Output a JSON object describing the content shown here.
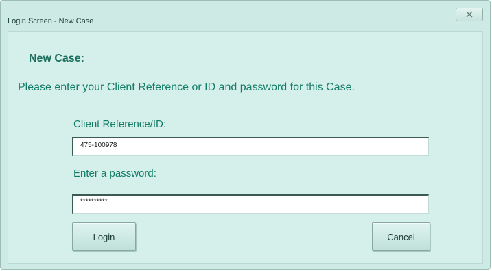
{
  "window": {
    "title": "Login Screen - New Case",
    "close_glyph": "✕"
  },
  "form": {
    "heading": "New Case:",
    "instruction": "Please enter your Client Reference or ID and password for this Case.",
    "client_label": "Client Reference/ID:",
    "client_value": "475-100978",
    "password_label": "Enter a password:",
    "password_value": "**********"
  },
  "buttons": {
    "login": "Login",
    "cancel": "Cancel"
  },
  "colors": {
    "window_bg": "#cdeae4",
    "accent_text": "#127c68",
    "heading_text": "#1c6f5f"
  }
}
